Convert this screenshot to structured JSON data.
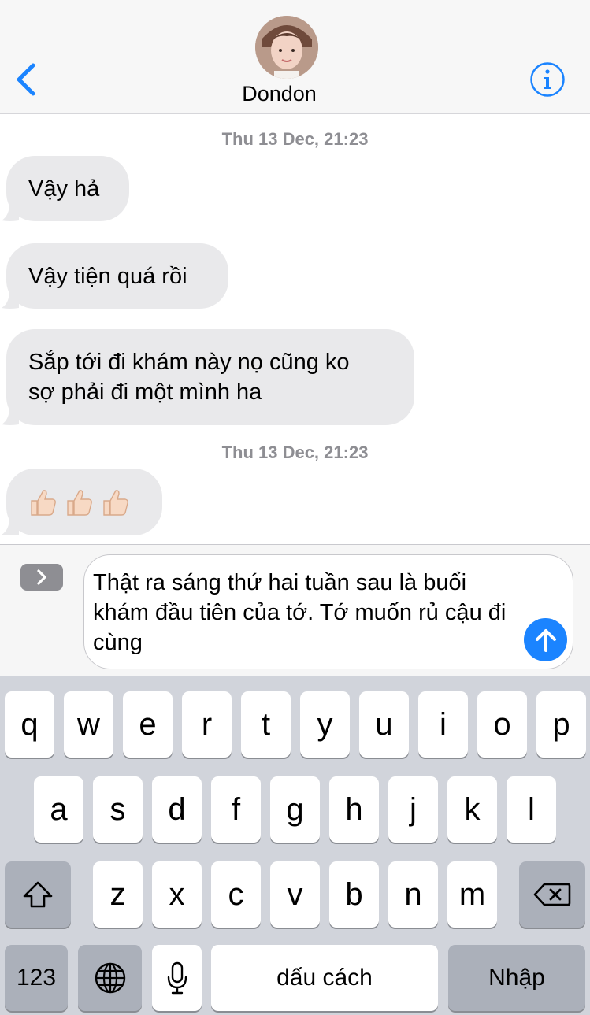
{
  "header": {
    "contact_name": "Dondon",
    "back_icon": "chevron-left-icon",
    "info_icon": "info-icon",
    "accent_color": "#1b84ff"
  },
  "thread": {
    "timestamps": [
      "Thu 13 Dec, 21:23",
      "Thu 13 Dec, 21:23"
    ],
    "messages": [
      {
        "text": "Vậy hả"
      },
      {
        "text": "Vậy tiện quá rồi"
      },
      {
        "lines": [
          "Sắp tới đi khám này nọ cũng ko",
          "sợ phải đi một mình ha"
        ]
      },
      {
        "emoji": [
          "thumbs-up",
          "thumbs-up",
          "thumbs-up"
        ]
      }
    ],
    "bubble_color": "#e9e9eb"
  },
  "composer": {
    "expand_icon": "chevron-right-icon",
    "draft_lines": [
      "Thật ra sáng thứ hai tuần sau là buổi",
      "khám đầu tiên của tớ. Tớ muốn rủ cậu đi",
      "cùng"
    ],
    "send_icon": "arrow-up-icon"
  },
  "keyboard": {
    "row1": [
      "q",
      "w",
      "e",
      "r",
      "t",
      "y",
      "u",
      "i",
      "o",
      "p"
    ],
    "row2": [
      "a",
      "s",
      "d",
      "f",
      "g",
      "h",
      "j",
      "k",
      "l"
    ],
    "row3": [
      "z",
      "x",
      "c",
      "v",
      "b",
      "n",
      "m"
    ],
    "numbers_key": "123",
    "space_key": "dấu cách",
    "return_key": "Nhập",
    "shift_icon": "shift-icon",
    "delete_icon": "backspace-icon",
    "globe_icon": "globe-icon",
    "mic_icon": "microphone-icon"
  }
}
